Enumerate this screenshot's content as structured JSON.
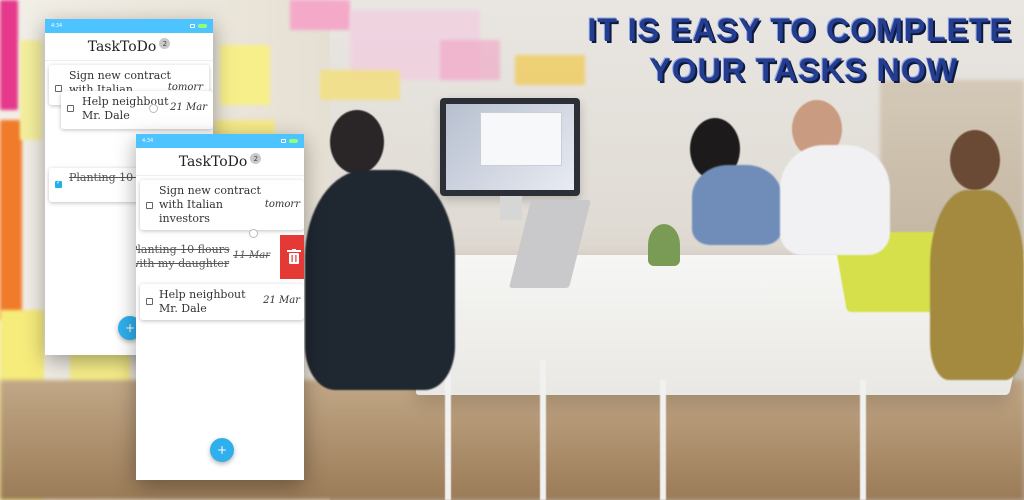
{
  "headline": {
    "line1": "IT IS EASY TO COMPLETE",
    "line2": "YOUR TASKS NOW",
    "color": "#243d8e"
  },
  "colors": {
    "statusbar": "#4dc3ff",
    "fab": "#2fb0ec",
    "delete": "#e53935",
    "checked": "#1db3e8"
  },
  "phone_back": {
    "status_time": "4:34",
    "app_title": "TaskToDo",
    "task_count": "2",
    "tasks": [
      {
        "text": "Sign new contract with Italian",
        "due": "tomorr",
        "done": false
      },
      {
        "text": "Help neighbout Mr. Dale",
        "due": "21 Mar",
        "done": false
      },
      {
        "text": "Planting 10 f... with my daugh...",
        "due": "",
        "done": true
      }
    ],
    "fab_icon": "+"
  },
  "phone_front": {
    "status_time": "4:34",
    "app_title": "TaskToDo",
    "task_count": "2",
    "tasks": [
      {
        "text": "Sign new contract with Italian investors",
        "due": "tomorr",
        "done": false
      },
      {
        "text": "Planting 10 flours with my daughter",
        "due": "11 Mar",
        "done": true
      },
      {
        "text": "Help neighbout Mr. Dale",
        "due": "21 Mar",
        "done": false
      }
    ],
    "delete_icon": "trash-icon",
    "fab_icon": "+"
  }
}
